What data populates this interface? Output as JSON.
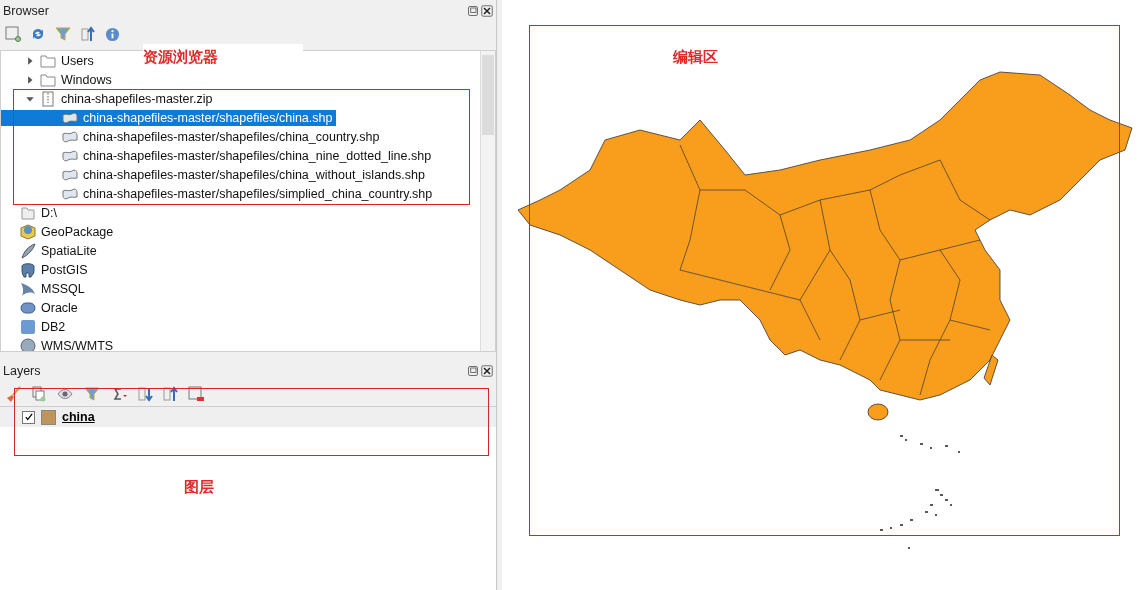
{
  "browser": {
    "title": "Browser",
    "tree": [
      {
        "label": "Users",
        "kind": "folder",
        "expanded": false,
        "selected": false
      },
      {
        "label": "Windows",
        "kind": "folder",
        "expanded": false,
        "selected": false
      },
      {
        "label": "china-shapefiles-master.zip",
        "kind": "zip",
        "expanded": true,
        "selected": false,
        "children": [
          {
            "label": "china-shapefiles-master/shapefiles/china.shp",
            "kind": "shapefile",
            "selected": true
          },
          {
            "label": "china-shapefiles-master/shapefiles/china_country.shp",
            "kind": "shapefile",
            "selected": false
          },
          {
            "label": "china-shapefiles-master/shapefiles/china_nine_dotted_line.shp",
            "kind": "shapefile",
            "selected": false
          },
          {
            "label": "china-shapefiles-master/shapefiles/china_without_islands.shp",
            "kind": "shapefile",
            "selected": false
          },
          {
            "label": "china-shapefiles-master/shapefiles/simplied_china_country.shp",
            "kind": "shapefile",
            "selected": false
          }
        ]
      },
      {
        "label": "D:\\",
        "kind": "drive",
        "selected": false
      },
      {
        "label": "GeoPackage",
        "kind": "geopackage",
        "selected": false
      },
      {
        "label": "SpatiaLite",
        "kind": "spatialite",
        "selected": false
      },
      {
        "label": "PostGIS",
        "kind": "postgis",
        "selected": false
      },
      {
        "label": "MSSQL",
        "kind": "mssql",
        "selected": false
      },
      {
        "label": "Oracle",
        "kind": "oracle",
        "selected": false
      },
      {
        "label": "DB2",
        "kind": "db2",
        "selected": false
      },
      {
        "label": "WMS/WMTS",
        "kind": "wms",
        "selected": false
      }
    ]
  },
  "layers": {
    "title": "Layers",
    "items": [
      {
        "name": "china",
        "checked": true,
        "color": "#bf955a"
      }
    ]
  },
  "annotations": [
    {
      "label": "资源浏览器"
    },
    {
      "label": "编辑区"
    },
    {
      "label": "图层"
    }
  ]
}
